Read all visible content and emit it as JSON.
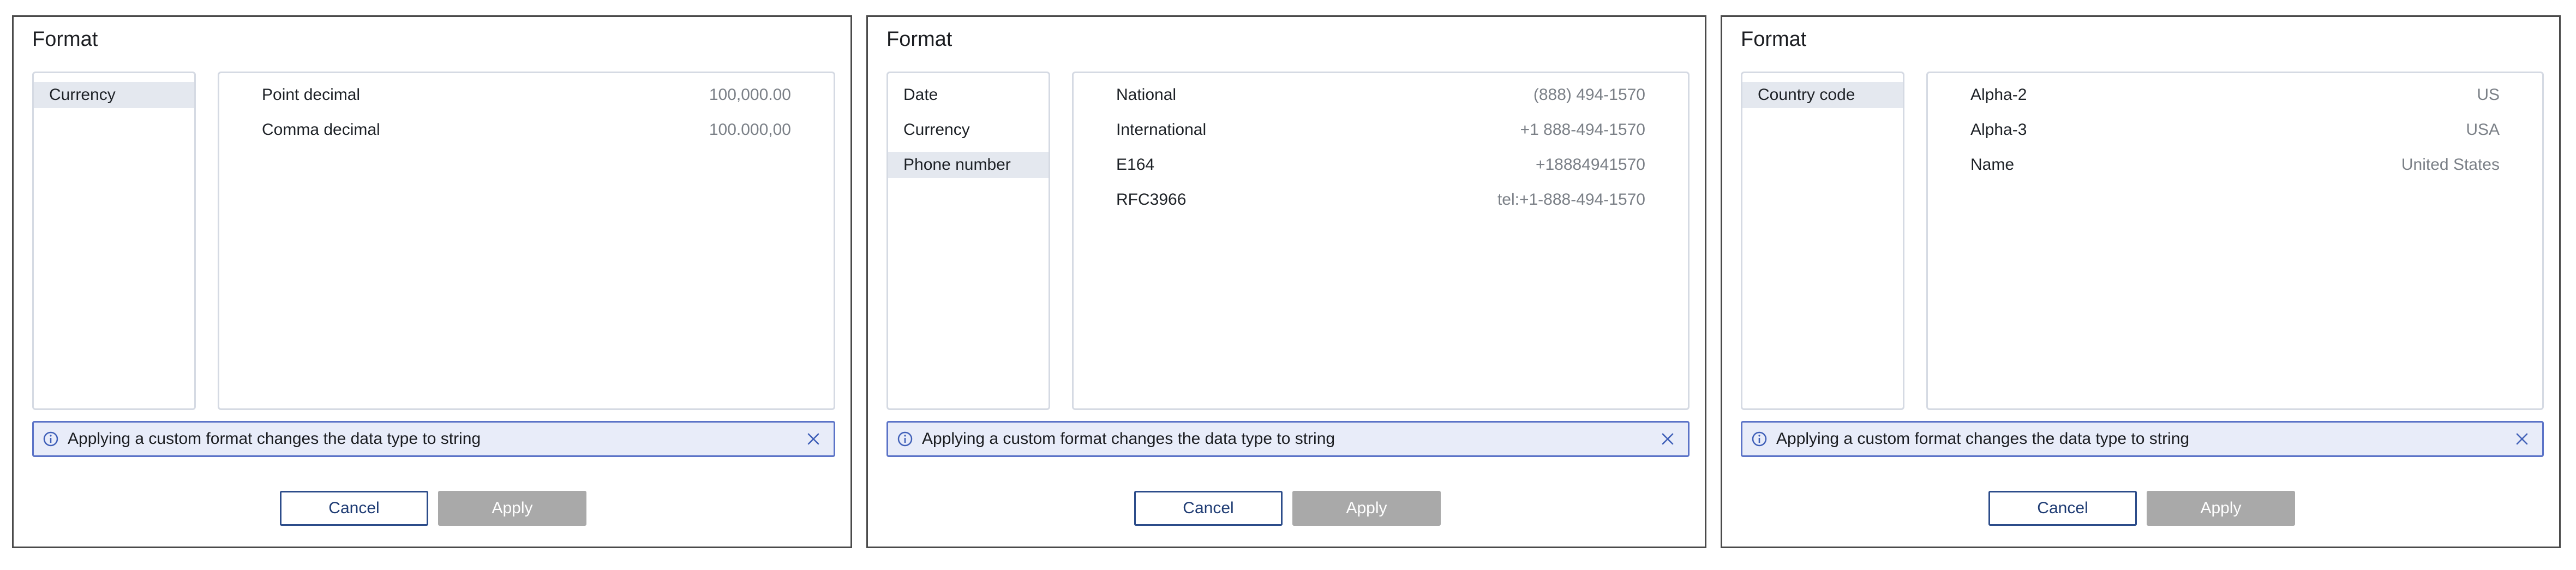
{
  "dialogs": [
    {
      "title": "Format",
      "categories": [
        {
          "label": "Currency",
          "selected": true
        }
      ],
      "options": [
        {
          "label": "Point decimal",
          "example": "100,000.00"
        },
        {
          "label": "Comma decimal",
          "example": "100.000,00"
        }
      ],
      "info_text": "Applying a custom format changes the data type to string",
      "cancel_label": "Cancel",
      "apply_label": "Apply"
    },
    {
      "title": "Format",
      "categories": [
        {
          "label": "Date",
          "selected": false
        },
        {
          "label": "Currency",
          "selected": false
        },
        {
          "label": "Phone number",
          "selected": true
        }
      ],
      "options": [
        {
          "label": "National",
          "example": "(888) 494-1570"
        },
        {
          "label": "International",
          "example": "+1 888-494-1570"
        },
        {
          "label": "E164",
          "example": "+18884941570"
        },
        {
          "label": "RFC3966",
          "example": "tel:+1-888-494-1570"
        }
      ],
      "info_text": "Applying a custom format changes the data type to string",
      "cancel_label": "Cancel",
      "apply_label": "Apply"
    },
    {
      "title": "Format",
      "categories": [
        {
          "label": "Country code",
          "selected": true
        }
      ],
      "options": [
        {
          "label": "Alpha-2",
          "example": "US"
        },
        {
          "label": "Alpha-3",
          "example": "USA"
        },
        {
          "label": "Name",
          "example": "United States"
        }
      ],
      "info_text": "Applying a custom format changes the data type to string",
      "cancel_label": "Cancel",
      "apply_label": "Apply"
    }
  ],
  "colors": {
    "selected_bg": "#e4e8ef",
    "info_bg": "#e8ecf9",
    "info_border": "#5b73c7",
    "cancel_border": "#2c4c8a",
    "apply_disabled": "#a9a9a9"
  },
  "icons": {
    "info": "info-circle-icon",
    "close": "close-icon"
  }
}
